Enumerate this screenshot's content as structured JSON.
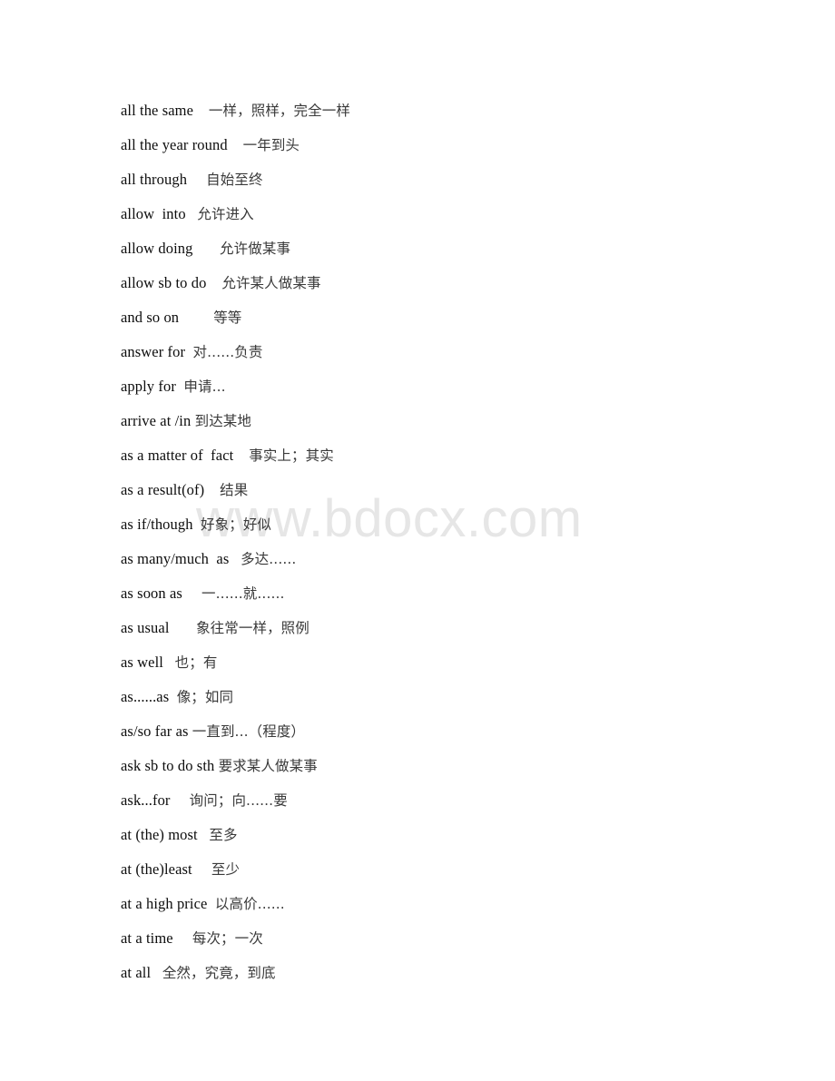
{
  "document": {
    "type": "phrase-glossary",
    "language_pair": "English-Chinese",
    "page_background": "#ffffff",
    "text_color": "#0d0d0d"
  },
  "watermark": {
    "text": "www.bdocx.com",
    "color": "#e6e6e6"
  },
  "entries": [
    {
      "term": "all the same",
      "sep": "    ",
      "gloss": "一样，照样，完全一样"
    },
    {
      "term": "all the year round",
      "sep": "    ",
      "gloss": "一年到头"
    },
    {
      "term": "all through",
      "sep": "     ",
      "gloss": "自始至终"
    },
    {
      "term": "allow  into",
      "sep": "   ",
      "gloss": "允许进入"
    },
    {
      "term": "allow doing",
      "sep": "       ",
      "gloss": "允许做某事"
    },
    {
      "term": "allow sb to do",
      "sep": "    ",
      "gloss": "允许某人做某事"
    },
    {
      "term": "and so on",
      "sep": "         ",
      "gloss": "等等"
    },
    {
      "term": "answer for",
      "sep": "  ",
      "gloss": "对......负责"
    },
    {
      "term": "apply for",
      "sep": "  ",
      "gloss": "申请..."
    },
    {
      "term": "arrive at /in",
      "sep": " ",
      "gloss": "到达某地"
    },
    {
      "term": "as a matter of  fact",
      "sep": "    ",
      "gloss": "事实上；其实"
    },
    {
      "term": "as a result(of)",
      "sep": "    ",
      "gloss": "结果"
    },
    {
      "term": "as if/though",
      "sep": "  ",
      "gloss": "好象；好似"
    },
    {
      "term": "as many/much  as",
      "sep": "   ",
      "gloss": "多达......"
    },
    {
      "term": "as soon as",
      "sep": "     ",
      "gloss": "一......就......"
    },
    {
      "term": "as usual",
      "sep": "       ",
      "gloss": "象往常一样，照例"
    },
    {
      "term": "as well",
      "sep": "   ",
      "gloss": "也；有"
    },
    {
      "term": "as......as",
      "sep": "  ",
      "gloss": "像；如同"
    },
    {
      "term": "as/so far as",
      "sep": " ",
      "gloss": "一直到...（程度）"
    },
    {
      "term": "ask sb to do sth",
      "sep": " ",
      "gloss": "要求某人做某事"
    },
    {
      "term": "ask...for",
      "sep": "     ",
      "gloss": "询问；向......要"
    },
    {
      "term": "at (the) most",
      "sep": "   ",
      "gloss": "至多"
    },
    {
      "term": "at (the)least",
      "sep": "     ",
      "gloss": "至少"
    },
    {
      "term": "at a high price",
      "sep": "  ",
      "gloss": "以高价......"
    },
    {
      "term": "at a time",
      "sep": "     ",
      "gloss": "每次；一次"
    },
    {
      "term": "at all",
      "sep": "   ",
      "gloss": "全然，究竟，到底"
    }
  ]
}
